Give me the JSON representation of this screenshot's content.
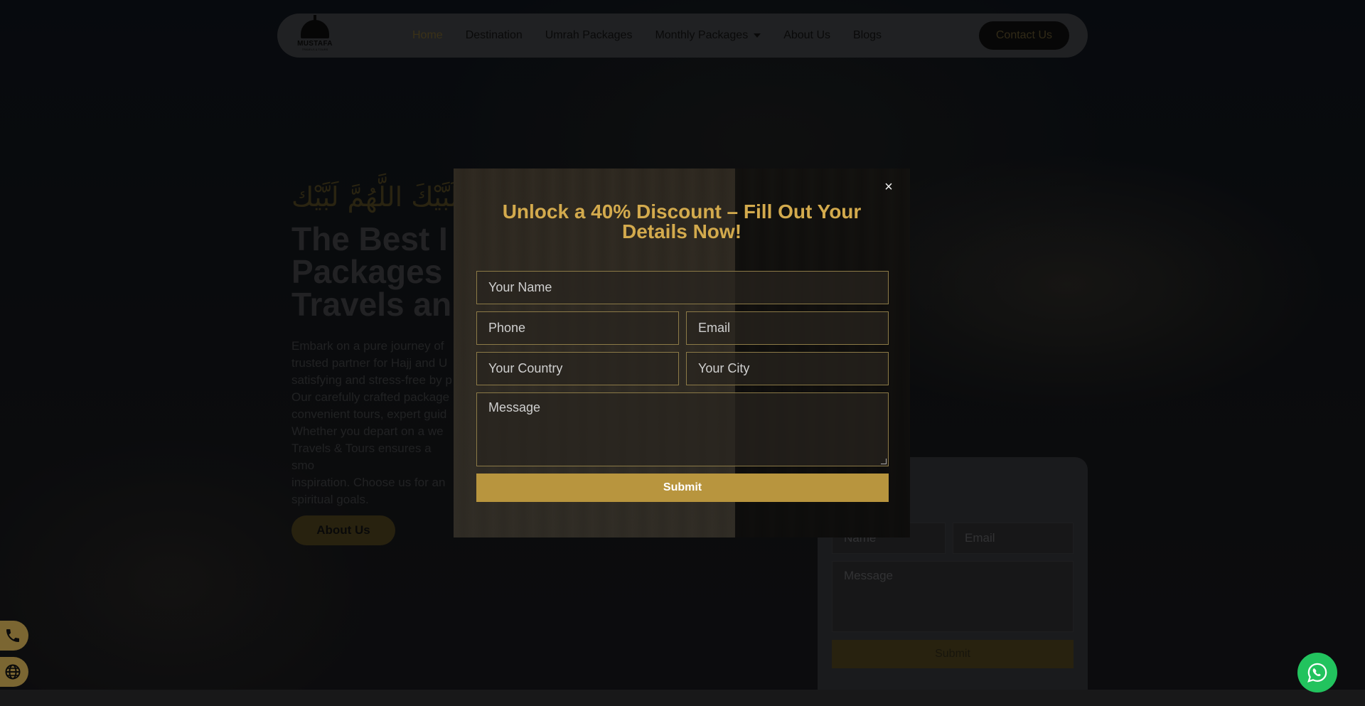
{
  "nav": {
    "logo_text": "MUSTAFA",
    "logo_sub": "TRAVELS & TOURS",
    "links": [
      "Home",
      "Destination",
      "Umrah Packages",
      "Monthly Packages",
      "About Us",
      "Blogs"
    ],
    "contact_label": "Contact Us"
  },
  "hero": {
    "arabic": "لَبَّيْكَ اللَّهُمَّ لَبَّيْك",
    "title": "The Best I\nPackages\nTravels an",
    "paragraph": "Embark on a pure journey of\ntrusted partner for Hajj and U\nsatisfying and stress-free by p\nOur carefully crafted package\nconvenient tours, expert guid\nWhether you depart on a we\nTravels & Tours ensures a smo\ninspiration. Choose us for an\nspiritual goals.",
    "button_label": "About Us"
  },
  "side_form": {
    "name_placeholder": "Name",
    "email_placeholder": "Email",
    "message_placeholder": "Message",
    "submit_label": "Submit"
  },
  "modal": {
    "title": "Unlock a 40% Discount – Fill Out Your Details Now!",
    "close_glyph": "×",
    "name_placeholder": "Your Name",
    "phone_placeholder": "Phone",
    "email_placeholder": "Email",
    "country_placeholder": "Your Country",
    "city_placeholder": "Your City",
    "message_placeholder": "Message",
    "submit_label": "Submit"
  },
  "floating": {
    "phone_icon": "phone-icon",
    "globe_icon": "globe-icon",
    "whatsapp_icon": "whatsapp-icon"
  },
  "colors": {
    "accent_gold": "#b8953e",
    "title_gold": "#d3aa4d",
    "whatsapp_green": "#22c35e"
  }
}
